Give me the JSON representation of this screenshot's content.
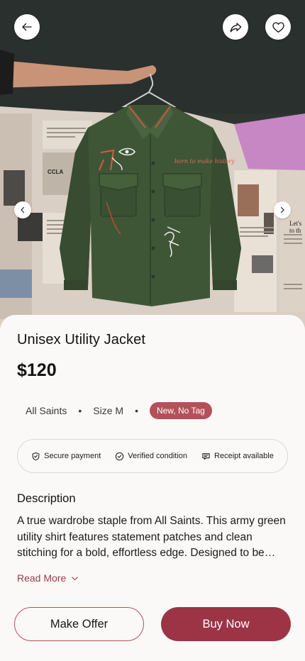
{
  "product": {
    "title": "Unisex Utility Jacket",
    "price": "$120",
    "brand": "All Saints",
    "size": "Size M",
    "condition_badge": "New, No Tag"
  },
  "trust": {
    "secure_payment": "Secure payment",
    "verified_condition": "Verified condition",
    "receipt_available": "Receipt available"
  },
  "description": {
    "heading": "Description",
    "text": "A true wardrobe staple from All Saints. This army green utility shirt features statement patches and clean stitching for a bold, effortless edge. Designed to be worn open or buttoned, it layers easily over tees and hoodies.",
    "read_more": "Read More"
  },
  "actions": {
    "make_offer": "Make Offer",
    "buy_now": "Buy Now"
  },
  "hero": {
    "paper_text_1": "CCLA",
    "paper_text_2": "Let's",
    "paper_text_3": "to th",
    "jacket_text": "born to make history"
  },
  "colors": {
    "accent": "#9c3446",
    "badge": "#b4505a",
    "jacket": "#3f5636"
  },
  "icons": {
    "back": "arrow-left-icon",
    "share": "share-icon",
    "favorite": "heart-icon",
    "prev": "chevron-left-icon",
    "next": "chevron-right-icon"
  }
}
